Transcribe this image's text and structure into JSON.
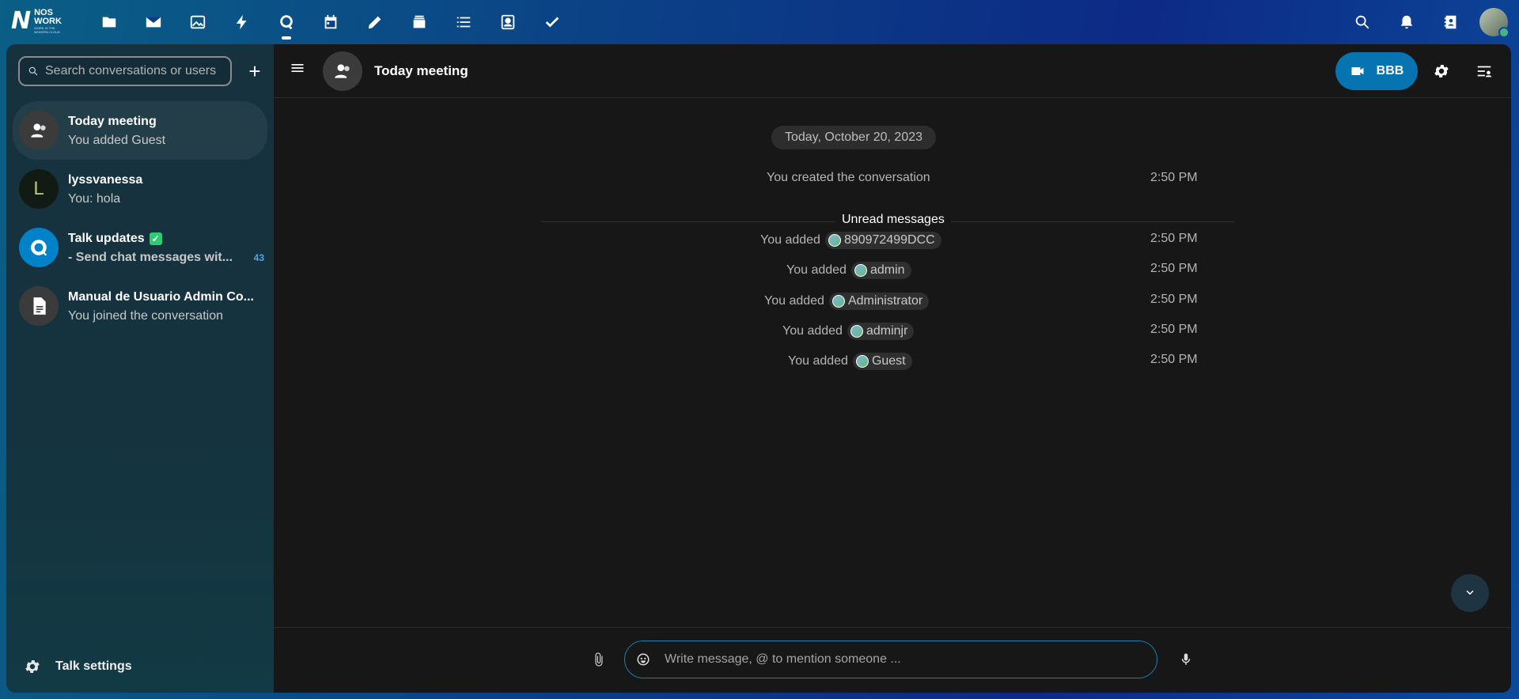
{
  "logo": {
    "letter": "N",
    "line1": "NOS",
    "line2": "WORK",
    "tagline": "WORK IN THE MODERN CLOUD"
  },
  "top_apps": [
    {
      "name": "files-icon"
    },
    {
      "name": "mail-icon"
    },
    {
      "name": "photos-icon"
    },
    {
      "name": "activity-icon"
    },
    {
      "name": "talk-icon",
      "active": true
    },
    {
      "name": "calendar-icon"
    },
    {
      "name": "notes-icon"
    },
    {
      "name": "deck-icon"
    },
    {
      "name": "tasks-list-icon"
    },
    {
      "name": "contacts-icon"
    },
    {
      "name": "tasks-check-icon"
    }
  ],
  "search": {
    "placeholder": "Search conversations or users"
  },
  "conversations": [
    {
      "name": "Today meeting",
      "subtitle": "You added Guest",
      "active": true,
      "avatar": "group-icon"
    },
    {
      "name": "lyssvanessa",
      "subtitle": "You: hola",
      "avatar_letter": "L"
    },
    {
      "name": "Talk updates",
      "subtitle": "- Send chat messages wit...",
      "unread": "43",
      "verified": "✓"
    },
    {
      "name": "Manual de Usuario Admin Co...",
      "subtitle": "You joined the conversation",
      "avatar": "document-icon"
    }
  ],
  "talk_settings_label": "Talk settings",
  "header": {
    "title": "Today meeting",
    "call_button": "BBB"
  },
  "messages": {
    "date": "Today, October 20, 2023",
    "created": {
      "text": "You created the conversation",
      "time": "2:50 PM"
    },
    "unread_label": "Unread messages",
    "added": [
      {
        "prefix": "You added",
        "user": "890972499DCC",
        "time": "2:50 PM"
      },
      {
        "prefix": "You added",
        "user": "admin",
        "time": "2:50 PM"
      },
      {
        "prefix": "You added",
        "user": "Administrator",
        "time": "2:50 PM"
      },
      {
        "prefix": "You added",
        "user": "adminjr",
        "time": "2:50 PM"
      },
      {
        "prefix": "You added",
        "user": "Guest",
        "time": "2:50 PM"
      }
    ]
  },
  "composer": {
    "placeholder": "Write message, @ to mention someone ..."
  },
  "colors": {
    "accent": "#0574b0",
    "verified": "#2ecc71",
    "online": "#49b382"
  }
}
